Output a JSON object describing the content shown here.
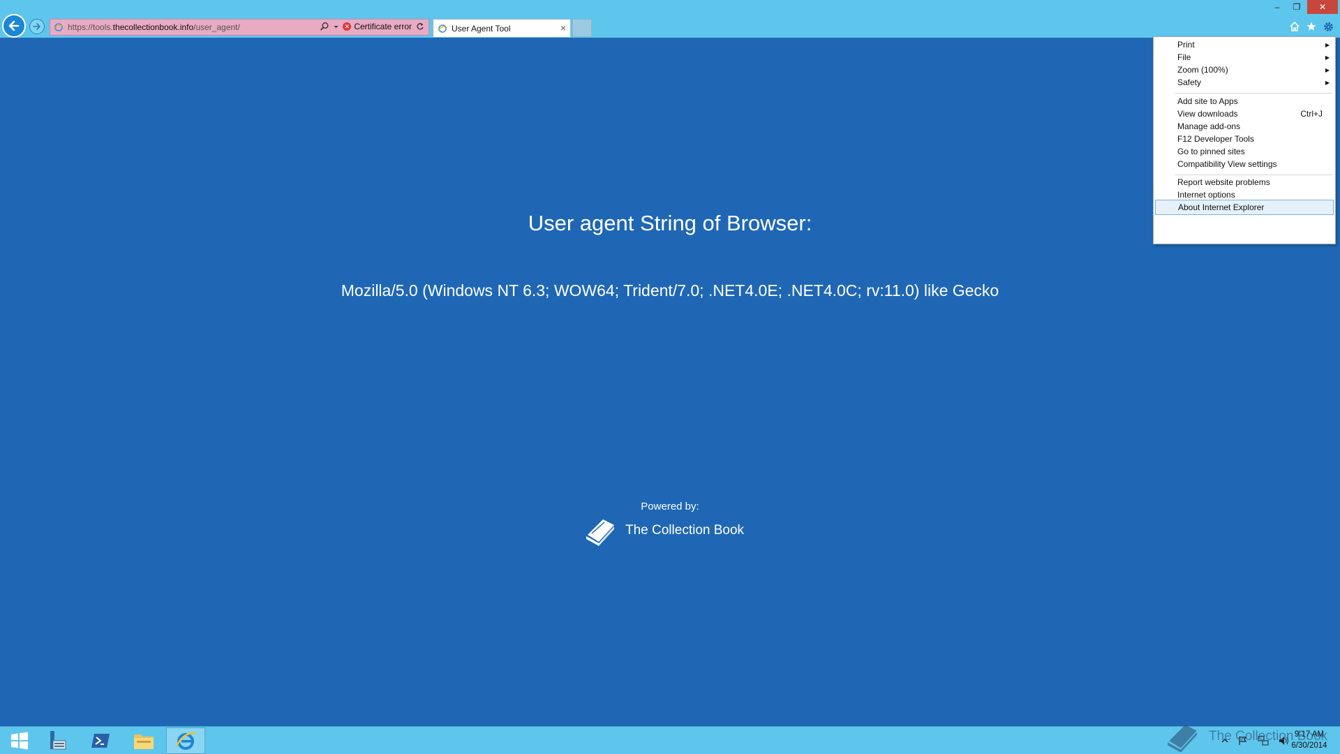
{
  "browser": {
    "address_url_prefix": "https://tools.",
    "address_url_domain": "thecollectionbook.info",
    "address_url_path": "/user_agent/",
    "certificate_error": "Certificate error",
    "tab_title": "User Agent Tool",
    "tab_close": "×"
  },
  "window_controls": {
    "minimize": "–",
    "maximize": "❐",
    "close": "✕"
  },
  "page": {
    "heading": "User agent String of Browser:",
    "user_agent": "Mozilla/5.0 (Windows NT 6.3; WOW64; Trident/7.0; .NET4.0E; .NET4.0C; rv:11.0) like Gecko",
    "powered_by": "Powered by:",
    "brand_name": "The Collection Book"
  },
  "menu": {
    "items": [
      {
        "label": "Print",
        "has_submenu": true
      },
      {
        "label": "File",
        "has_submenu": true
      },
      {
        "label": "Zoom (100%)",
        "has_submenu": true
      },
      {
        "label": "Safety",
        "has_submenu": true
      },
      {
        "label": "Add site to Apps"
      },
      {
        "label": "View downloads",
        "shortcut": "Ctrl+J"
      },
      {
        "label": "Manage add-ons"
      },
      {
        "label": "F12 Developer Tools"
      },
      {
        "label": "Go to pinned sites"
      },
      {
        "label": "Compatibility View settings"
      },
      {
        "label": "Report website problems"
      },
      {
        "label": "Internet options"
      },
      {
        "label": "About Internet Explorer",
        "highlighted": true
      }
    ]
  },
  "taskbar": {
    "watermark": "The Collection Book",
    "time": "9:17 AM",
    "date": "6/30/2014"
  },
  "colors": {
    "page_background": "#1f67b4",
    "chrome_background": "#5ec6ec",
    "address_error_background": "#e9aac4",
    "menu_highlight": "#e5f1fb"
  }
}
